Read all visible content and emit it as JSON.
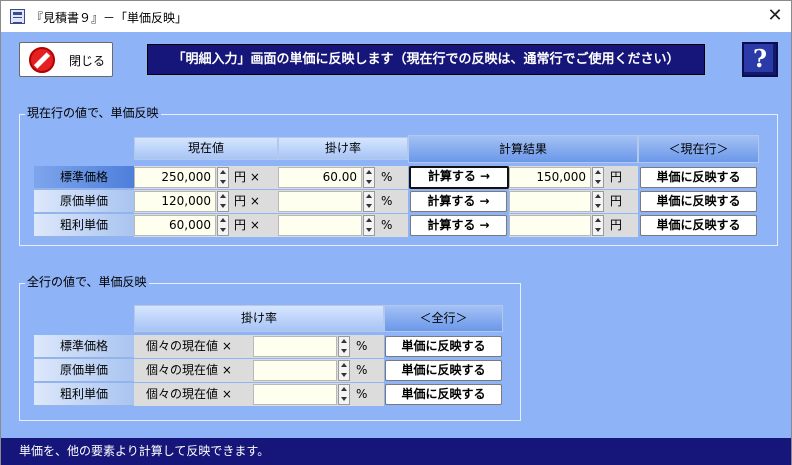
{
  "window": {
    "title": "『見積書９』－「単価反映」",
    "close_glyph": "✕"
  },
  "toolbar": {
    "close_button_label": "閉じる",
    "help_glyph": "?"
  },
  "banner": "「明細入力」画面の単価に反映します（現在行での反映は、通常行でご使用ください）",
  "current_row_section": {
    "title": "現在行の値で、単価反映",
    "headers": {
      "current_value": "現在値",
      "rate": "掛け率",
      "result": "計算結果",
      "apply": "＜現在行＞"
    },
    "rows": [
      {
        "label": "標準価格",
        "current_value": "250,000",
        "current_unit": "円 ×",
        "rate": "60.00",
        "rate_unit": "%",
        "calc_label": "計算する →",
        "result": "150,000",
        "result_unit": "円",
        "apply_label": "単価に反映する"
      },
      {
        "label": "原価単価",
        "current_value": "120,000",
        "current_unit": "円 ×",
        "rate": "",
        "rate_unit": "%",
        "calc_label": "計算する →",
        "result": "",
        "result_unit": "円",
        "apply_label": "単価に反映する"
      },
      {
        "label": "粗利単価",
        "current_value": "60,000",
        "current_unit": "円 ×",
        "rate": "",
        "rate_unit": "%",
        "calc_label": "計算する →",
        "result": "",
        "result_unit": "円",
        "apply_label": "単価に反映する"
      }
    ]
  },
  "all_rows_section": {
    "title": "全行の値で、単価反映",
    "headers": {
      "rate": "掛け率",
      "apply": "＜全行＞"
    },
    "rows": [
      {
        "label": "標準価格",
        "prefix": "個々の現在値 ×",
        "rate": "",
        "rate_unit": "%",
        "apply_label": "単価に反映する"
      },
      {
        "label": "原価単価",
        "prefix": "個々の現在値 ×",
        "rate": "",
        "rate_unit": "%",
        "apply_label": "単価に反映する"
      },
      {
        "label": "粗利単価",
        "prefix": "個々の現在値 ×",
        "rate": "",
        "rate_unit": "%",
        "apply_label": "単価に反映する"
      }
    ]
  },
  "status_bar": "単価を、他の要素より計算して反映できます。",
  "colors": {
    "background": "#8fb3f7",
    "banner": "#16167a",
    "input": "#fffff0",
    "close_icon": "#e52020"
  }
}
